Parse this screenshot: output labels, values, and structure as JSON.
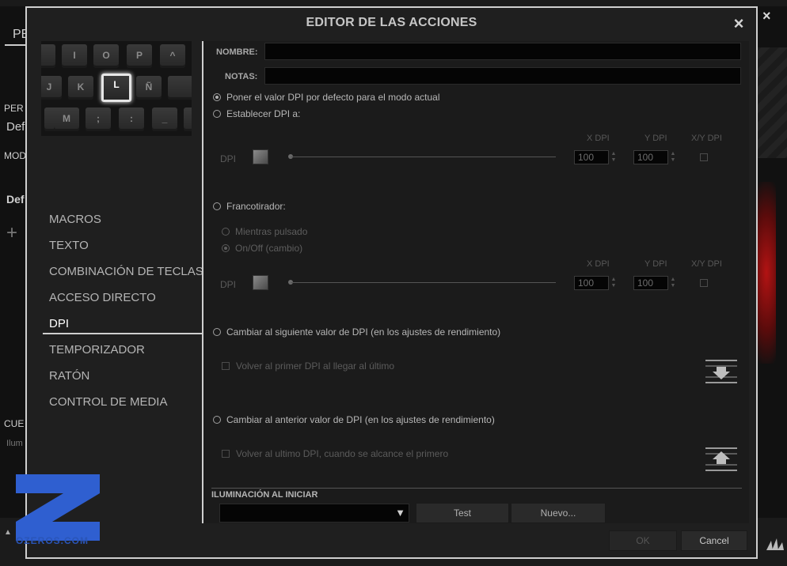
{
  "background": {
    "top_left_label": "PE",
    "sidebar_labels": [
      "PER",
      "Def",
      "MOD",
      "Def",
      "CUE",
      "Ilum"
    ],
    "close_glyph": "×"
  },
  "dialog": {
    "title": "EDITOR DE LAS ACCIONES",
    "close_glyph": "×"
  },
  "keyboard": {
    "rows": [
      [
        "",
        "I",
        "O",
        "P",
        "^"
      ],
      [
        "J",
        "K",
        "L",
        "Ñ",
        ""
      ],
      [
        "",
        "M",
        ";",
        ":",
        "_",
        ""
      ]
    ],
    "selected_key": "L"
  },
  "actions": {
    "items": [
      "MACROS",
      "TEXTO",
      "COMBINACIÓN DE TECLAS",
      "ACCESO DIRECTO",
      "DPI",
      "TEMPORIZADOR",
      "RATÓN",
      "CONTROL DE MEDIA"
    ],
    "active": "DPI"
  },
  "form": {
    "name_label": "NOMBRE:",
    "name_value": "",
    "notes_label": "NOTAS:",
    "notes_value": "",
    "opt_default": "Poner el valor DPI por defecto para el modo actual",
    "opt_set": "Establecer DPI a:",
    "x_dpi_hdr": "X DPI",
    "y_dpi_hdr": "Y DPI",
    "xy_dpi_hdr": "X/Y DPI",
    "dpi_label": "DPI",
    "set_x_value": "100",
    "set_y_value": "100",
    "opt_sniper": "Francotirador:",
    "sniper_while_pressed": "Mientras pulsado",
    "sniper_toggle": "On/Off (cambio)",
    "sniper_x_value": "100",
    "sniper_y_value": "100",
    "opt_next": "Cambiar al siguiente valor de DPI (en los ajustes de rendimiento)",
    "chk_next_wrap": "Volver al primer DPI al llegar al último",
    "opt_prev": "Cambiar al anterior valor de DPI (en los ajustes de rendimiento)",
    "chk_prev_wrap": "Volver al ultimo DPI, cuando se alcance el primero",
    "lighting_label": "ILUMINACIÓN AL INICIAR",
    "dropdown_caret": "▼",
    "test_button": "Test",
    "new_button": "Nuevo...",
    "ok_button": "OK",
    "cancel_button": "Cancel"
  },
  "watermark": {
    "text": "OZEROS.COM"
  }
}
